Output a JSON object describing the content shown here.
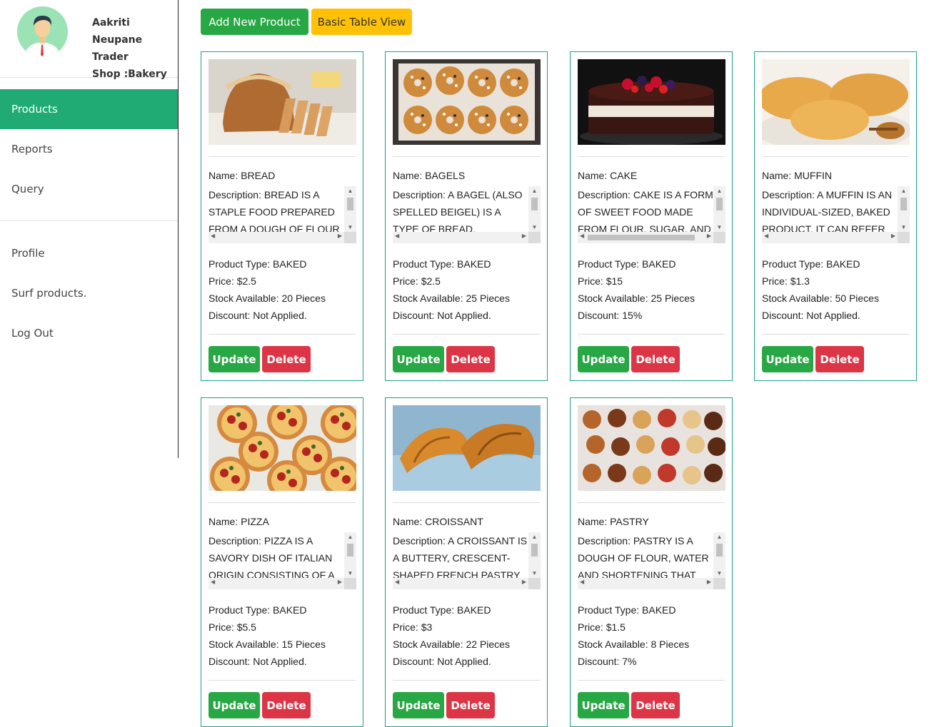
{
  "profile": {
    "name": "Aakriti Neupane",
    "role": "Trader",
    "shop": "Shop :Bakery",
    "avatar_icon": "user-avatar-icon"
  },
  "nav": {
    "products": "Products",
    "reports": "Reports",
    "query": "Query",
    "profile": "Profile",
    "surf": "Surf products.",
    "logout": "Log Out"
  },
  "toolbar": {
    "add_label": "Add New Product",
    "basic_label": "Basic Table View"
  },
  "colors": {
    "accent": "#20ab74",
    "success": "#28a745",
    "warning": "#ffc107",
    "danger": "#dc3545",
    "card_border": "#20a08a"
  },
  "labels": {
    "name": "Name:",
    "description": "Description:",
    "type": "Product Type:",
    "price": "Price:",
    "stock": "Stock Available:",
    "discount": "Discount:",
    "update": "Update",
    "delete": "Delete"
  },
  "products": [
    {
      "name": "BREAD",
      "description": "BREAD IS A STAPLE FOOD PREPARED FROM A DOUGH OF FLOUR",
      "type": "BAKED",
      "price": "$2.5",
      "stock": "20 Pieces",
      "discount": "Not Applied.",
      "image_icon": "bread-image"
    },
    {
      "name": "BAGELS",
      "description": "A BAGEL (ALSO SPELLED BEIGEL) IS A TYPE OF BREAD, TRADITIONALLY",
      "type": "BAKED",
      "price": "$2.5",
      "stock": "25 Pieces",
      "discount": "Not Applied.",
      "image_icon": "bagels-image"
    },
    {
      "name": "CAKE",
      "description": "CAKE IS A FORM OF SWEET FOOD MADE FROM FLOUR, SUGAR, AND",
      "type": "BAKED",
      "price": "$15",
      "stock": "25 Pieces",
      "discount": "15%",
      "image_icon": "cake-image"
    },
    {
      "name": "MUFFIN",
      "description": "A MUFFIN IS AN INDIVIDUAL-SIZED, BAKED PRODUCT. IT CAN REFER TO",
      "type": "BAKED",
      "price": "$1.3",
      "stock": "50 Pieces",
      "discount": "Not Applied.",
      "image_icon": "muffin-image"
    },
    {
      "name": "PIZZA",
      "description": "PIZZA IS A SAVORY DISH OF ITALIAN ORIGIN CONSISTING OF A",
      "type": "BAKED",
      "price": "$5.5",
      "stock": "15 Pieces",
      "discount": "Not Applied.",
      "image_icon": "pizza-image"
    },
    {
      "name": "CROISSANT",
      "description": "A CROISSANT IS A BUTTERY, CRESCENT-SHAPED FRENCH PASTRY",
      "type": "BAKED",
      "price": "$3",
      "stock": "22 Pieces",
      "discount": "Not Applied.",
      "image_icon": "croissant-image"
    },
    {
      "name": "PASTRY",
      "description": "PASTRY IS A DOUGH OF FLOUR, WATER AND SHORTENING THAT",
      "type": "BAKED",
      "price": "$1.5",
      "stock": "8 Pieces",
      "discount": "7%",
      "image_icon": "pastry-image"
    }
  ]
}
